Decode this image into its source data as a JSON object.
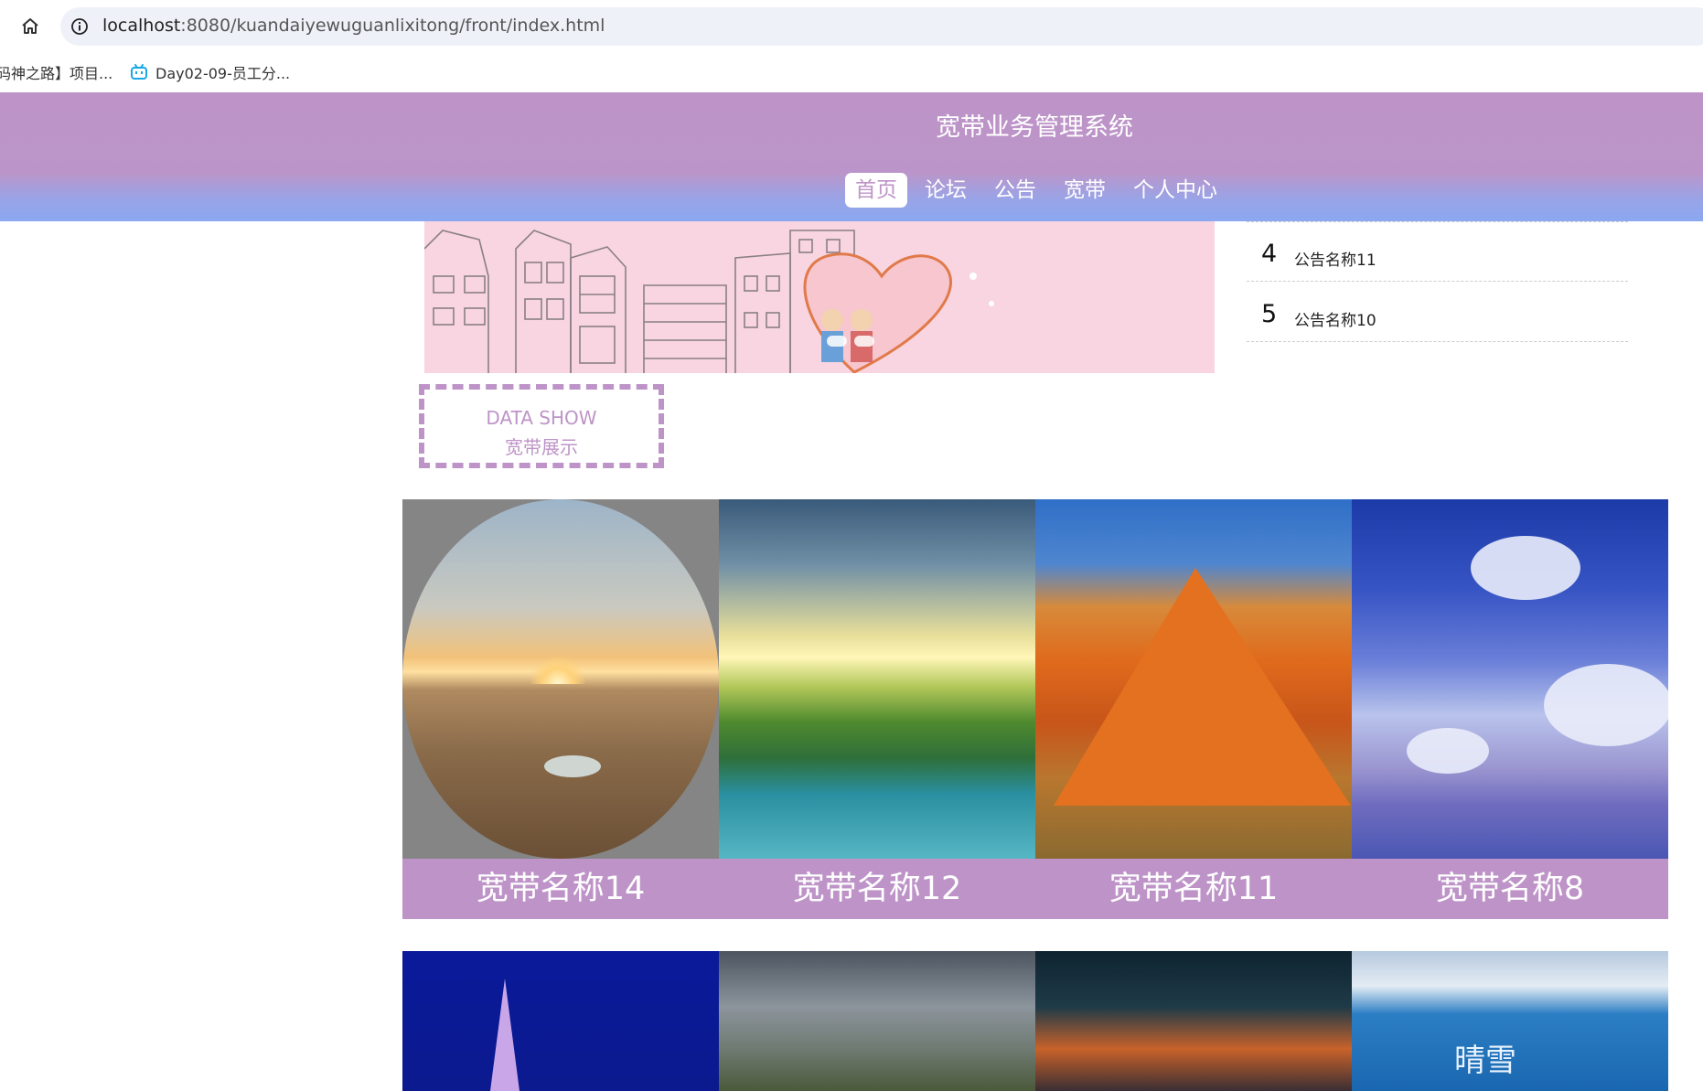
{
  "browser": {
    "url_host": "localhost",
    "url_path": ":8080/kuandaiyewuguanlixitong/front/index.html",
    "bookmarks": [
      "码神之路】项目...",
      "Day02-09-员工分..."
    ]
  },
  "header": {
    "title": "宽带业务管理系统",
    "nav": [
      "首页",
      "论坛",
      "公告",
      "宽带",
      "个人中心"
    ],
    "active_nav": "首页"
  },
  "notices": [
    {
      "num": "4",
      "title": "公告名称11"
    },
    {
      "num": "5",
      "title": "公告名称10"
    }
  ],
  "section": {
    "en": "DATA SHOW",
    "zh": "宽带展示"
  },
  "products": [
    {
      "name": "宽带名称14"
    },
    {
      "name": "宽带名称12"
    },
    {
      "name": "宽带名称11"
    },
    {
      "name": "宽带名称8"
    }
  ],
  "colors": {
    "accent": "#be94c8",
    "header_gradient_end": "#8aa8f0",
    "banner_bg": "#f8d5e0"
  }
}
